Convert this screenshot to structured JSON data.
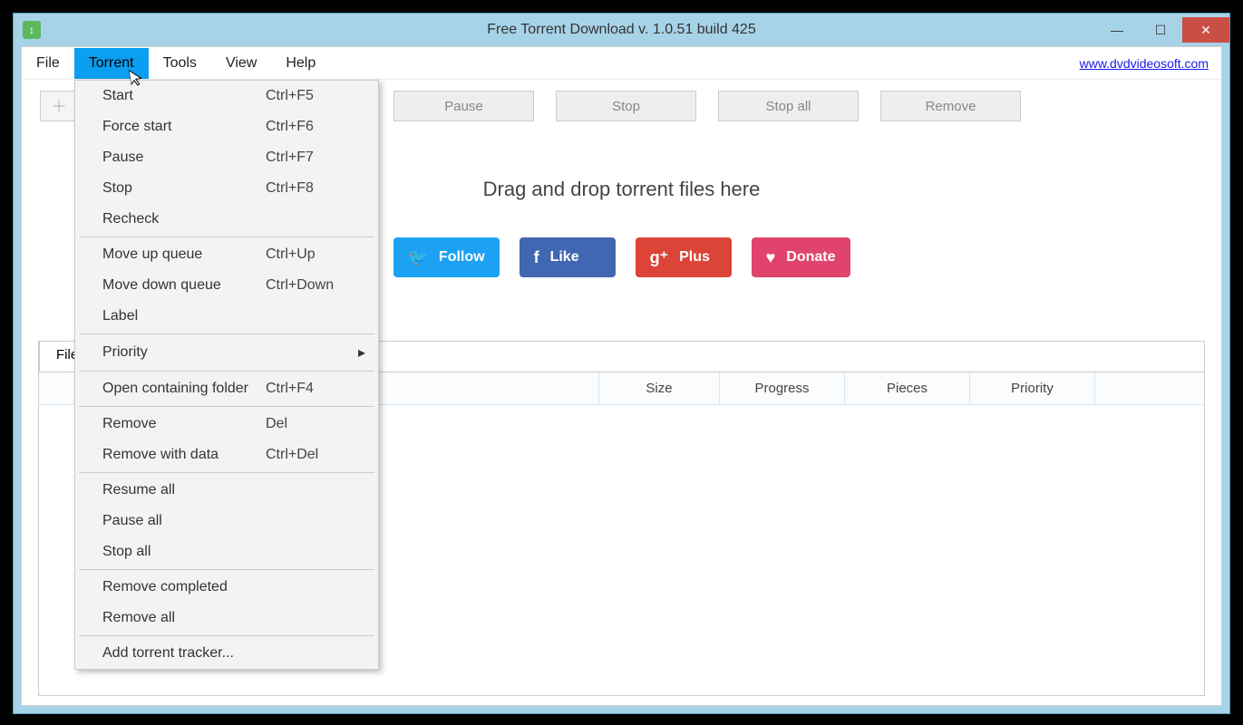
{
  "window": {
    "title": "Free Torrent Download v. 1.0.51 build 425"
  },
  "menubar": {
    "items": [
      "File",
      "Torrent",
      "Tools",
      "View",
      "Help"
    ],
    "link": "www.dvdvideosoft.com"
  },
  "toolbar": {
    "pause": "Pause",
    "stop": "Stop",
    "stopall": "Stop all",
    "remove": "Remove"
  },
  "drop": {
    "text": "Drag and drop torrent files here"
  },
  "social": {
    "follow": "Follow",
    "like": "Like",
    "plus": "Plus",
    "donate": "Donate"
  },
  "tabs": {
    "files": "Files"
  },
  "columns": {
    "filename": "",
    "size": "Size",
    "progress": "Progress",
    "pieces": "Pieces",
    "priority": "Priority"
  },
  "dropdown": [
    {
      "label": "Start",
      "shortcut": "Ctrl+F5"
    },
    {
      "label": "Force start",
      "shortcut": "Ctrl+F6"
    },
    {
      "label": "Pause",
      "shortcut": "Ctrl+F7"
    },
    {
      "label": "Stop",
      "shortcut": "Ctrl+F8"
    },
    {
      "label": "Recheck",
      "shortcut": ""
    },
    {
      "sep": true
    },
    {
      "label": "Move up queue",
      "shortcut": "Ctrl+Up"
    },
    {
      "label": "Move down queue",
      "shortcut": "Ctrl+Down"
    },
    {
      "label": "Label",
      "shortcut": ""
    },
    {
      "sep": true
    },
    {
      "label": "Priority",
      "shortcut": "",
      "submenu": true
    },
    {
      "sep": true
    },
    {
      "label": "Open containing folder",
      "shortcut": "Ctrl+F4"
    },
    {
      "sep": true
    },
    {
      "label": "Remove",
      "shortcut": "Del"
    },
    {
      "label": "Remove with data",
      "shortcut": "Ctrl+Del"
    },
    {
      "sep": true
    },
    {
      "label": "Resume all",
      "shortcut": ""
    },
    {
      "label": "Pause all",
      "shortcut": ""
    },
    {
      "label": "Stop all",
      "shortcut": ""
    },
    {
      "sep": true
    },
    {
      "label": "Remove completed",
      "shortcut": ""
    },
    {
      "label": "Remove all",
      "shortcut": ""
    },
    {
      "sep": true
    },
    {
      "label": "Add torrent tracker...",
      "shortcut": ""
    }
  ]
}
